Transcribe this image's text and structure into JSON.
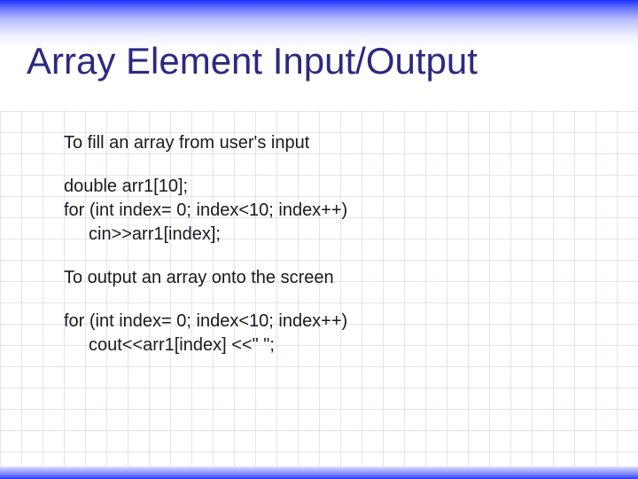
{
  "slide": {
    "title": "Array Element Input/Output",
    "body": {
      "intro1": "To fill an array from user's input",
      "code1_l1": "double arr1[10];",
      "code1_l2": "for (int index= 0; index<10; index++)",
      "code1_l3": "cin>>arr1[index];",
      "intro2": "To output an array onto the screen",
      "code2_l1": "for (int index= 0; index<10; index++)",
      "code2_l2": "cout<<arr1[index] <<\" \";"
    }
  }
}
